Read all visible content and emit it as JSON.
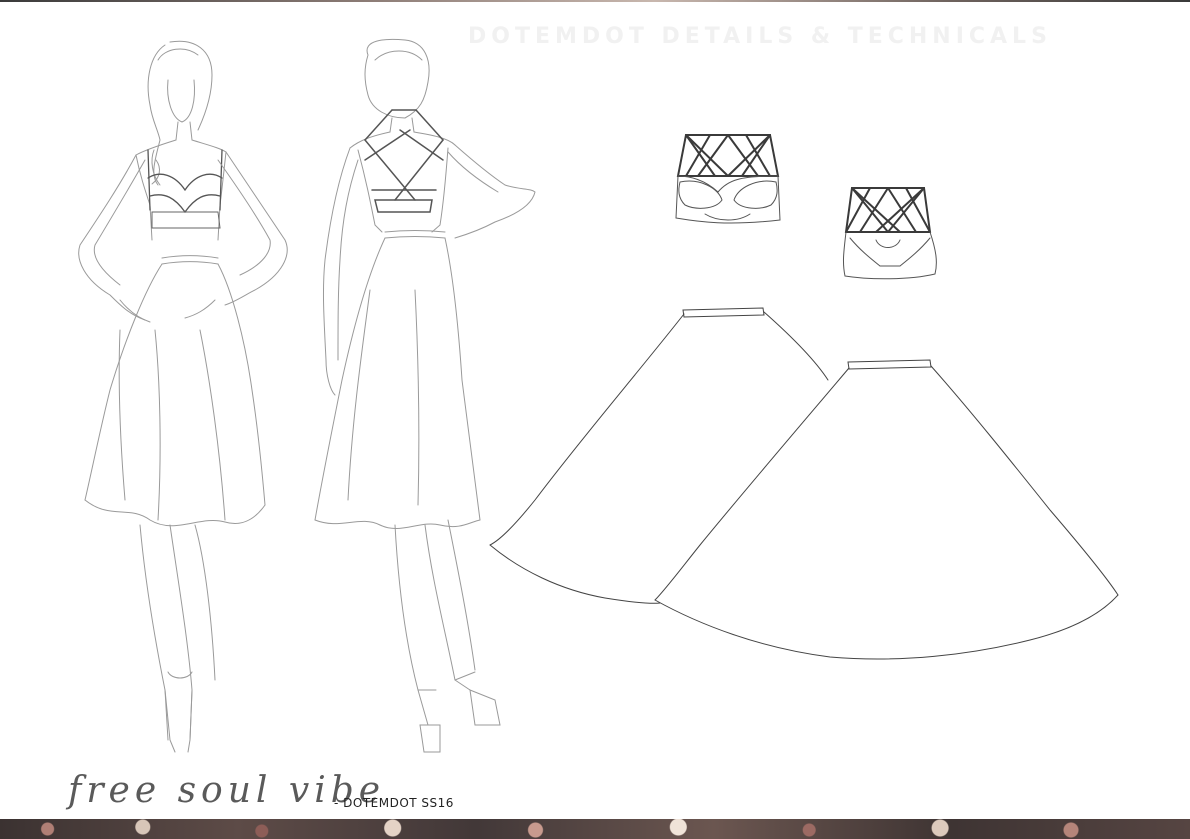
{
  "page": {
    "heading": "DOTEMDOT DETAILS & TECHNICALS"
  },
  "footer": {
    "script": "free soul vibe",
    "collection": "- DOTEMDOT SS16"
  },
  "colors": {
    "background": "#ffffff",
    "sketch_line": "#9a9a9a",
    "flat_line": "#444444",
    "strap_line": "#3a3a3a",
    "footer_text": "#222222"
  },
  "figures": [
    {
      "view": "front"
    },
    {
      "view": "back"
    }
  ],
  "flats": [
    {
      "garment": "bralette",
      "view": "front"
    },
    {
      "garment": "bralette",
      "view": "back"
    },
    {
      "garment": "skirt",
      "view": "front"
    },
    {
      "garment": "skirt",
      "view": "back"
    }
  ]
}
